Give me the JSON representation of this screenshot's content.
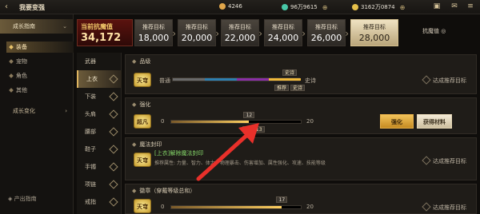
{
  "topbar": {
    "back_icon": "‹",
    "title": "我要变强",
    "resources": [
      {
        "icon": "coin-icon",
        "value": "4246",
        "color": "#e0a64a"
      },
      {
        "icon": "gem-icon",
        "value": "96万9615",
        "color": "#48c8a8"
      },
      {
        "icon": "gold-icon",
        "value": "3162万0874",
        "color": "#e6c04a"
      }
    ]
  },
  "sidebar": {
    "groups": [
      {
        "label": "成长指南",
        "active": true
      },
      {
        "label": "成长变化",
        "active": false
      }
    ],
    "items": [
      {
        "label": "装备",
        "active": true
      },
      {
        "label": "宠物",
        "active": false
      },
      {
        "label": "角色",
        "active": false
      },
      {
        "label": "其他",
        "active": false
      }
    ],
    "footer": "产出指南"
  },
  "power": {
    "label": "当前抗魔值",
    "value": "34,172"
  },
  "targets": [
    {
      "label": "推荐目标",
      "value": "18,000"
    },
    {
      "label": "推荐目标",
      "value": "20,000"
    },
    {
      "label": "推荐目标",
      "value": "22,000"
    },
    {
      "label": "推荐目标",
      "value": "24,000"
    },
    {
      "label": "推荐目标",
      "value": "26,000"
    },
    {
      "label": "推荐目标",
      "value": "28,000"
    }
  ],
  "kangmo_label": "抗魔值",
  "categories": [
    {
      "label": "武器",
      "active": false
    },
    {
      "label": "上衣",
      "active": true
    },
    {
      "label": "下装",
      "active": false
    },
    {
      "label": "头肩",
      "active": false
    },
    {
      "label": "腰部",
      "active": false
    },
    {
      "label": "鞋子",
      "active": false
    },
    {
      "label": "手镯",
      "active": false
    },
    {
      "label": "项链",
      "active": false
    },
    {
      "label": "戒指",
      "active": false
    }
  ],
  "sections": {
    "grade": {
      "title": "品级",
      "badge": "天穹",
      "left_label": "普通",
      "right_label": "史诗",
      "top_tag": "史诗",
      "bottom_tags": [
        "推荐",
        "史诗"
      ],
      "achieve": "达成推荐目标"
    },
    "enhance": {
      "title": "强化",
      "badge": "超凡",
      "min": "0",
      "max": "20",
      "current": "12",
      "current_value": 12,
      "max_value": 20,
      "recommend_tag": "推荐 13",
      "btn_enhance": "强化",
      "btn_material": "获得材料"
    },
    "seal": {
      "title": "魔法封印",
      "badge": "天穹",
      "green": "[上衣]解除魔法封印",
      "desc": "推荐属性: 力量、智力、体力、物理暴击、伤害增加、属性强化、攻速、技能等级",
      "achieve": "达成推荐目标"
    },
    "emblem": {
      "title": "徽章（穿戴等级总和）",
      "badge": "天穹",
      "min": "0",
      "max": "20",
      "current": "17",
      "current_value": 17,
      "max_value": 20,
      "achieve": "达成推荐目标"
    }
  }
}
